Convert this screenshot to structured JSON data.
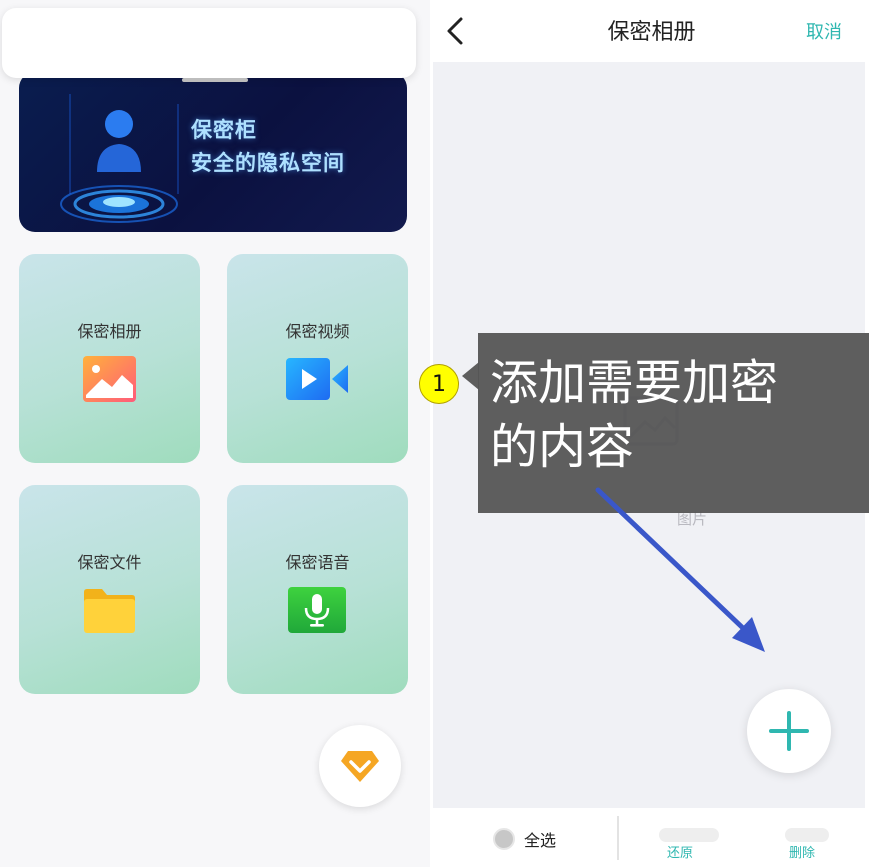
{
  "left_panel": {
    "banner": {
      "line1": "保密柜",
      "line2": "安全的隐私空间"
    },
    "cards": {
      "album": "保密相册",
      "video": "保密视频",
      "file": "保密文件",
      "voice": "保密语音"
    }
  },
  "right_panel": {
    "nav": {
      "title": "保密相册",
      "cancel": "取消"
    },
    "placeholder_label": "图片",
    "bottom_bar": {
      "select_all": "全选",
      "restore": "还原",
      "delete": "删除"
    }
  },
  "annotation": {
    "step": "1",
    "text_line1": "添加需要加密",
    "text_line2": "的内容"
  },
  "colors": {
    "accent": "#2fb7b0",
    "arrow": "#3a57c9",
    "marker": "#ffff00",
    "vip": "#f5a623"
  }
}
